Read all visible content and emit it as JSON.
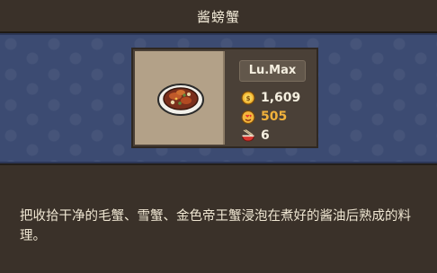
{
  "dialog": {
    "title": "酱螃蟹"
  },
  "dish": {
    "image_icon": "crab-dish-icon",
    "level": "Lu.Max",
    "stats": {
      "price": {
        "icon": "coin-icon",
        "value": "1,609",
        "color": "#f4eedf"
      },
      "popularity": {
        "icon": "heart-face-icon",
        "value": "505",
        "color": "#f1b23b"
      },
      "servings": {
        "icon": "bowl-chopsticks-icon",
        "value": "6",
        "color": "#f4eedf"
      }
    }
  },
  "description": {
    "text": "把收拾干净的毛蟹、雪蟹、金色帝王蟹浸泡在煮好的酱油后熟成的料理。"
  },
  "colors": {
    "banner": "#3c4b72",
    "panel": "#3a3129",
    "card": "#4a4037",
    "dish_bg": "#b3a188",
    "accent": "#f1b23b"
  }
}
